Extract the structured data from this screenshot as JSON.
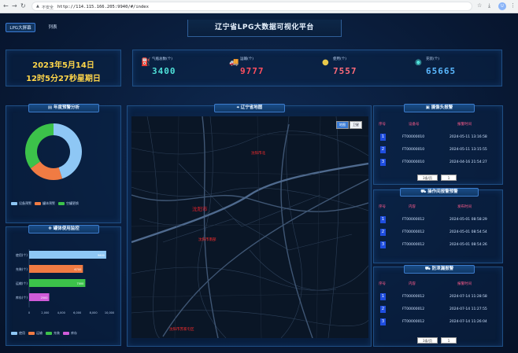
{
  "browser": {
    "insecure_label": "不安全",
    "url": "http://114.115.166.205:9940/#/index"
  },
  "nav": {
    "tab_dashboard": "LPG大屏幕",
    "tab_list": "列表"
  },
  "header": {
    "title": "辽宁省LPG大数据可视化平台"
  },
  "datetime": {
    "date": "2023年5月14日",
    "time": "12时5分27秒星期日"
  },
  "stats": [
    {
      "label": "气瓶总数(个)",
      "value": "3400",
      "icon": "gas-cylinder-icon",
      "color": "#4fe0d8"
    },
    {
      "label": "运输(个)",
      "value": "9777",
      "icon": "truck-icon",
      "color": "#ff4f5f"
    },
    {
      "label": "使用(个)",
      "value": "7557",
      "icon": "usage-icon",
      "color": "#ff6b7a"
    },
    {
      "label": "充装(个)",
      "value": "65665",
      "icon": "filling-icon",
      "color": "#5ab8ff"
    }
  ],
  "annual_warning": {
    "title": "年度预警分析",
    "chart_data": {
      "type": "pie",
      "donut": true,
      "labels": [
        "设备预警",
        "罐体预警",
        "空罐更换"
      ],
      "values": [
        45,
        20,
        35
      ],
      "colors": [
        "#8ec7f5",
        "#f07b43",
        "#3cc24a"
      ]
    }
  },
  "tank_monitor": {
    "title": "罐体使用监控",
    "chart_data": {
      "type": "bar",
      "orientation": "horizontal",
      "categories": [
        "使用(个)",
        "充装(个)",
        "运输(个)",
        "库存(个)"
      ],
      "values": [
        9600,
        6700,
        7000,
        2500
      ],
      "value_labels": [
        "9600",
        "6700",
        "7000",
        "2500"
      ],
      "colors": [
        "#8ec7f5",
        "#f07b43",
        "#3cc24a",
        "#d05bd8"
      ],
      "xticks": [
        "0",
        "2,000",
        "4,000",
        "6,000",
        "8,000",
        "10,000"
      ],
      "xlim": [
        0,
        10000
      ]
    },
    "legend": [
      "使用",
      "运输",
      "充装",
      "库存"
    ]
  },
  "map": {
    "title": "辽宁省地图",
    "btn_map": "地图",
    "btn_satellite": "卫星",
    "cities": [
      {
        "name": "沈阳市北"
      },
      {
        "name": "沈阳市"
      },
      {
        "name": "沈阳市南部"
      },
      {
        "name": "沈阳市苏家屯区"
      }
    ]
  },
  "camera_alarm": {
    "title": "摄像头报警",
    "headers": [
      "序号",
      "设备号",
      "报警时间"
    ],
    "rows": [
      {
        "no": "1",
        "device": "FT00000010",
        "time": "2024-05-11 13:16:58"
      },
      {
        "no": "2",
        "device": "FT00000010",
        "time": "2024-05-11 13:15:55"
      },
      {
        "no": "3",
        "device": "FT00000010",
        "time": "2024-04-16 21:54:27"
      }
    ],
    "pager": "3条/页",
    "page": "1"
  },
  "operation_alarm": {
    "title": "操作间报警预警",
    "headers": [
      "序号",
      "内容",
      "发布时间"
    ],
    "rows": [
      {
        "no": "1",
        "device": "FT00000012",
        "time": "2024-05-01 08:58:29"
      },
      {
        "no": "2",
        "device": "FT00000012",
        "time": "2024-05-01 08:54:54"
      },
      {
        "no": "3",
        "device": "FT00000012",
        "time": "2024-05-01 08:54:26"
      }
    ]
  },
  "leak_alarm": {
    "title": "防泄漏报警",
    "headers": [
      "序号",
      "内容",
      "报警时间"
    ],
    "rows": [
      {
        "no": "1",
        "device": "FT00000012",
        "time": "2024-07-14 11:28:58"
      },
      {
        "no": "2",
        "device": "FT00000012",
        "time": "2024-07-14 11:27:55"
      },
      {
        "no": "3",
        "device": "FT00000012",
        "time": "2024-07-14 11:26:04"
      }
    ],
    "pager": "3条/页",
    "page": "1"
  }
}
